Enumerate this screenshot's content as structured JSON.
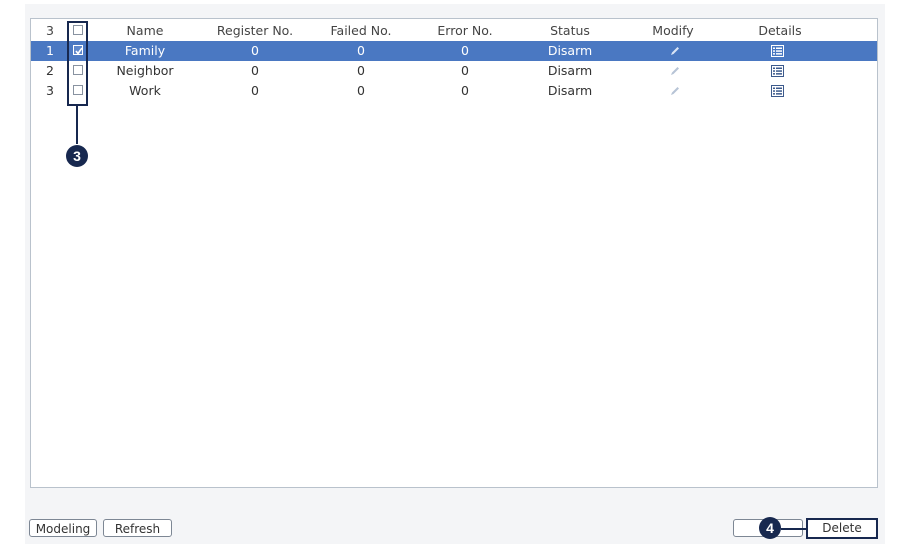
{
  "table": {
    "header": {
      "count": "3",
      "name": "Name",
      "register_no": "Register No.",
      "failed_no": "Failed No.",
      "error_no": "Error No.",
      "status": "Status",
      "modify": "Modify",
      "details": "Details"
    },
    "rows": [
      {
        "index": "1",
        "name": "Family",
        "register_no": "0",
        "failed_no": "0",
        "error_no": "0",
        "status": "Disarm",
        "checked": true,
        "selected": true
      },
      {
        "index": "2",
        "name": "Neighbor",
        "register_no": "0",
        "failed_no": "0",
        "error_no": "0",
        "status": "Disarm",
        "checked": false,
        "selected": false
      },
      {
        "index": "3",
        "name": "Work",
        "register_no": "0",
        "failed_no": "0",
        "error_no": "0",
        "status": "Disarm",
        "checked": false,
        "selected": false
      }
    ]
  },
  "callouts": {
    "checkbox_column": "3",
    "delete_button": "4"
  },
  "buttons": {
    "modeling": "Modeling",
    "refresh": "Refresh",
    "blank": "",
    "delete": "Delete"
  },
  "colors": {
    "selected_row": "#4a78c2",
    "callout": "#17284f",
    "border": "#b9c2cc"
  },
  "icons": {
    "modify": "pencil-icon",
    "details": "details-list-icon",
    "checkbox": "checkbox-icon"
  }
}
